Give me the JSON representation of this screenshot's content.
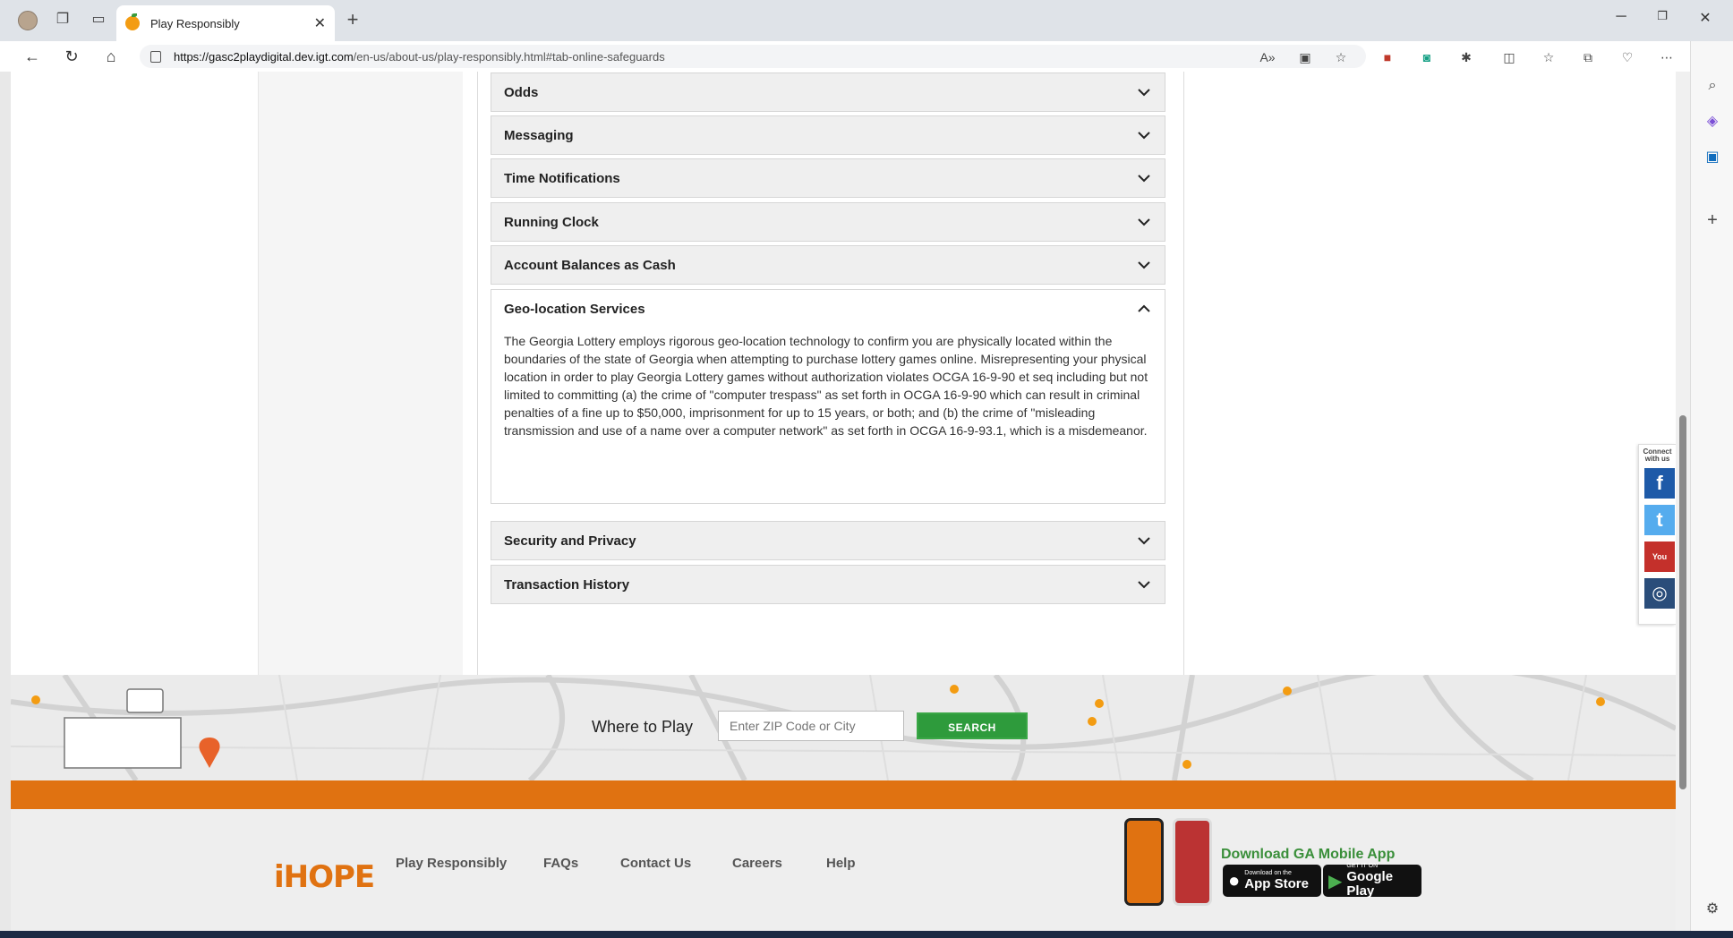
{
  "browser": {
    "tab_title": "Play Responsibly",
    "url_host": "https://gasc2playdigital.dev.igt.com",
    "url_path": "/en-us/about-us/play-responsibly.html#tab-online-safeguards"
  },
  "accordion": {
    "items": [
      {
        "label": "Odds",
        "open": false
      },
      {
        "label": "Messaging",
        "open": false
      },
      {
        "label": "Time Notifications",
        "open": false
      },
      {
        "label": "Running Clock",
        "open": false
      },
      {
        "label": "Account Balances as Cash",
        "open": false
      },
      {
        "label": "Geo-location Services",
        "open": true
      },
      {
        "label": "Security and Privacy",
        "open": false
      },
      {
        "label": "Transaction History",
        "open": false
      }
    ],
    "geo_body": "The Georgia Lottery employs rigorous geo-location technology to confirm you are physically located within the boundaries of the state of Georgia when attempting to purchase lottery games online.  Misrepresenting your physical location in order to play Georgia Lottery games without authorization violates OCGA 16-9-90 et seq including but not limited to committing (a) the crime of \"computer trespass\" as set forth in OCGA 16-9-90 which can result in criminal penalties of a fine up to $50,000, imprisonment for up to 15 years, or both; and (b) the crime of \"misleading transmission and use of a name over a computer network\" as set forth in OCGA 16-9-93.1, which is a misdemeanor."
  },
  "social": {
    "connect_label": "Connect with us",
    "facebook": "f",
    "twitter": "t",
    "youtube": "You Tube",
    "instagram": "◎"
  },
  "where_to_play": {
    "label": "Where to Play",
    "placeholder": "Enter ZIP Code or City",
    "search_label": "SEARCH"
  },
  "footer": {
    "logo_text": "iHOPE",
    "links": [
      "Play Responsibly",
      "FAQs",
      "Contact Us",
      "Careers",
      "Help"
    ],
    "app_title": "Download GA Mobile App",
    "appstore_small": "Download on the",
    "appstore_big": "App Store",
    "googleplay_small": "GET IT ON",
    "googleplay_big": "Google Play"
  },
  "colors": {
    "accent_orange": "#e07211",
    "search_green": "#2e9b3c",
    "facebook": "#1e5aa8",
    "twitter": "#55acee",
    "youtube": "#c4302b",
    "instagram": "#2a4d7a"
  }
}
